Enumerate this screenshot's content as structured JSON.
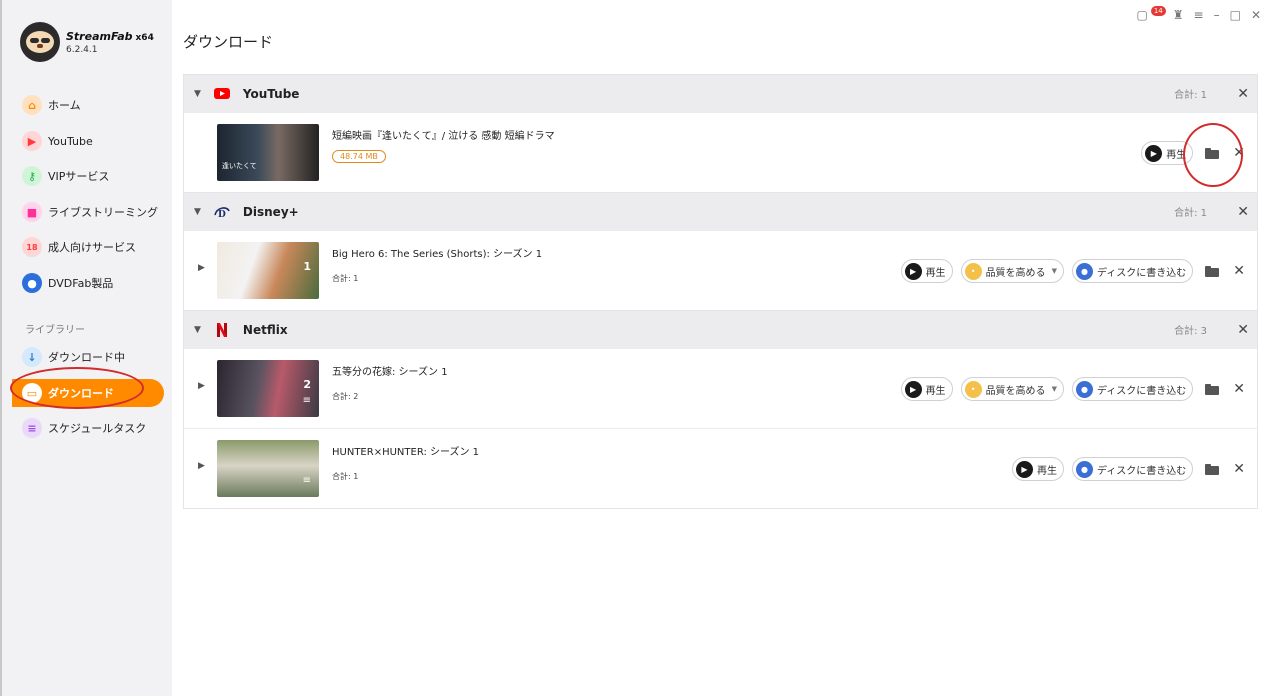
{
  "app": {
    "name": "StreamFab",
    "arch": "x64",
    "version": "6.2.4.1"
  },
  "window_controls": {
    "notifications_count": "14"
  },
  "sidebar": {
    "items": [
      {
        "label": "ホーム",
        "icon": "home-icon",
        "color": "#ff9a3c"
      },
      {
        "label": "YouTube",
        "icon": "youtube-icon",
        "color": "#ff4d4d"
      },
      {
        "label": "VIPサービス",
        "icon": "key-icon",
        "color": "#3ccf5e"
      },
      {
        "label": "ライブストリーミング",
        "icon": "camera-icon",
        "color": "#ff4fa8"
      },
      {
        "label": "成人向けサービス",
        "icon": "adult-icon",
        "color": "#ff5a5a"
      },
      {
        "label": "DVDFab製品",
        "icon": "dvdfab-icon",
        "color": "#2a6fdb"
      }
    ],
    "library_label": "ライブラリー",
    "library": [
      {
        "label": "ダウンロード中",
        "icon": "download-arrow-icon",
        "color": "#3a8ee6"
      },
      {
        "label": "ダウンロード",
        "icon": "folder-icon",
        "color": "#ff8a00",
        "active": true
      },
      {
        "label": "スケジュールタスク",
        "icon": "task-icon",
        "color": "#a35ee0"
      }
    ]
  },
  "main": {
    "title": "ダウンロード"
  },
  "groups": [
    {
      "name": "YouTube",
      "total": "合計: 1",
      "rows": [
        {
          "title": "短編映画『逢いたくて』/ 泣ける 感動 短編ドラマ",
          "size": "48.74 MB",
          "thumb_caption": "逢いたくて",
          "play": "再生"
        }
      ]
    },
    {
      "name": "Disney+",
      "total": "合計: 1",
      "rows": [
        {
          "title": "Big Hero 6: The Series (Shorts): シーズン 1",
          "subtitle": "合計: 1",
          "count": "1",
          "play": "再生",
          "quality": "品質を高める",
          "burn": "ディスクに書き込む"
        }
      ]
    },
    {
      "name": "Netflix",
      "total": "合計: 3",
      "rows": [
        {
          "title": "五等分の花嫁: シーズン 1",
          "subtitle": "合計: 2",
          "count": "2",
          "play": "再生",
          "quality": "品質を高める",
          "burn": "ディスクに書き込む"
        },
        {
          "title": "HUNTER×HUNTER: シーズン 1",
          "subtitle": "合計: 1",
          "play": "再生",
          "burn": "ディスクに書き込む"
        }
      ]
    }
  ]
}
